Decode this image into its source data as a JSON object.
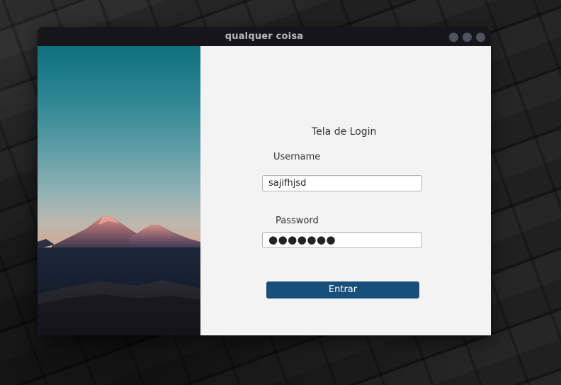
{
  "window": {
    "title": "qualquer coisa",
    "controls": [
      "minimize",
      "maximize",
      "close"
    ]
  },
  "image": {
    "subject": "mountain-landscape"
  },
  "form": {
    "heading": "Tela de Login",
    "username_label": "Username",
    "username_value": "sajifhjsd",
    "password_label": "Password",
    "password_masked": "●●●●●●●",
    "submit_label": "Entrar"
  },
  "colors": {
    "titlebar": "#16161a",
    "form_background": "#f3f3f3",
    "button": "#174e7b",
    "window_controls": "#4e5360"
  }
}
